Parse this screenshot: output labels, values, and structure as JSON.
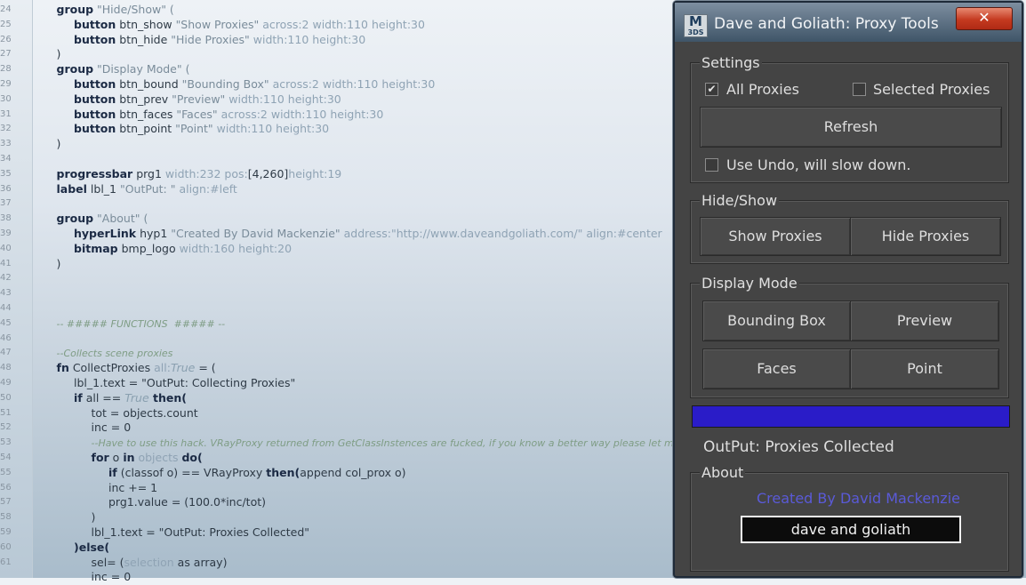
{
  "editor": {
    "line_numbers": [
      "24",
      "25",
      "26",
      "27",
      "28",
      "29",
      "30",
      "31",
      "32",
      "33",
      "34",
      "35",
      "36",
      "37",
      "38",
      "39",
      "40",
      "41",
      "42",
      "43",
      "44",
      "45",
      "46",
      "47",
      "48",
      "49",
      "50",
      "51",
      "52",
      "53",
      "54",
      "55",
      "56",
      "57",
      "58",
      "59",
      "60",
      "61"
    ],
    "lines": [
      {
        "indent": 1,
        "tokens": [
          {
            "t": "group",
            "c": "kw"
          },
          {
            "t": " \"Hide/Show\" (",
            "c": "str"
          }
        ]
      },
      {
        "indent": 2,
        "tokens": [
          {
            "t": "button",
            "c": "kw"
          },
          {
            "t": " btn_show ",
            "c": "plain"
          },
          {
            "t": "\"Show Proxies\"",
            "c": "str"
          },
          {
            "t": " across:2 width:110 height:30",
            "c": "prop"
          }
        ]
      },
      {
        "indent": 2,
        "tokens": [
          {
            "t": "button",
            "c": "kw"
          },
          {
            "t": " btn_hide ",
            "c": "plain"
          },
          {
            "t": "\"Hide Proxies\"",
            "c": "str"
          },
          {
            "t": " width:110 height:30",
            "c": "prop"
          }
        ]
      },
      {
        "indent": 1,
        "tokens": [
          {
            "t": ")",
            "c": "plain"
          }
        ]
      },
      {
        "indent": 1,
        "tokens": [
          {
            "t": "group",
            "c": "kw"
          },
          {
            "t": " \"Display Mode\" (",
            "c": "str"
          }
        ]
      },
      {
        "indent": 2,
        "tokens": [
          {
            "t": "button",
            "c": "kw"
          },
          {
            "t": " btn_bound ",
            "c": "plain"
          },
          {
            "t": "\"Bounding Box\"",
            "c": "str"
          },
          {
            "t": " across:2 width:110 height:30",
            "c": "prop"
          }
        ]
      },
      {
        "indent": 2,
        "tokens": [
          {
            "t": "button",
            "c": "kw"
          },
          {
            "t": " btn_prev ",
            "c": "plain"
          },
          {
            "t": "\"Preview\"",
            "c": "str"
          },
          {
            "t": " width:110 height:30",
            "c": "prop"
          }
        ]
      },
      {
        "indent": 2,
        "tokens": [
          {
            "t": "button",
            "c": "kw"
          },
          {
            "t": " btn_faces ",
            "c": "plain"
          },
          {
            "t": "\"Faces\"",
            "c": "str"
          },
          {
            "t": " across:2 width:110 height:30",
            "c": "prop"
          }
        ]
      },
      {
        "indent": 2,
        "tokens": [
          {
            "t": "button",
            "c": "kw"
          },
          {
            "t": " btn_point ",
            "c": "plain"
          },
          {
            "t": "\"Point\"",
            "c": "str"
          },
          {
            "t": " width:110 height:30",
            "c": "prop"
          }
        ]
      },
      {
        "indent": 1,
        "tokens": [
          {
            "t": ")",
            "c": "plain"
          }
        ]
      },
      {
        "indent": 0,
        "tokens": []
      },
      {
        "indent": 1,
        "tokens": [
          {
            "t": "progressbar",
            "c": "kw"
          },
          {
            "t": " prg1 ",
            "c": "plain"
          },
          {
            "t": "width:232 pos:",
            "c": "prop"
          },
          {
            "t": "[4,260]",
            "c": "plain"
          },
          {
            "t": "height:19",
            "c": "prop"
          }
        ]
      },
      {
        "indent": 1,
        "tokens": [
          {
            "t": "label",
            "c": "kw"
          },
          {
            "t": " lbl_1 ",
            "c": "plain"
          },
          {
            "t": "\"OutPut: \"",
            "c": "str"
          },
          {
            "t": " align:#left",
            "c": "prop"
          }
        ]
      },
      {
        "indent": 0,
        "tokens": []
      },
      {
        "indent": 1,
        "tokens": [
          {
            "t": "group",
            "c": "kw"
          },
          {
            "t": " \"About\" (",
            "c": "str"
          }
        ]
      },
      {
        "indent": 2,
        "tokens": [
          {
            "t": "hyperLink",
            "c": "kw"
          },
          {
            "t": " hyp1 ",
            "c": "plain"
          },
          {
            "t": "\"Created By David Mackenzie\"",
            "c": "str"
          },
          {
            "t": " address:\"http://www.daveandgoliath.com/\" align:#center",
            "c": "prop"
          }
        ]
      },
      {
        "indent": 2,
        "tokens": [
          {
            "t": "bitmap",
            "c": "kw"
          },
          {
            "t": " bmp_logo ",
            "c": "plain"
          },
          {
            "t": "width:160 height:20",
            "c": "prop"
          }
        ]
      },
      {
        "indent": 1,
        "tokens": [
          {
            "t": ")",
            "c": "plain"
          }
        ]
      },
      {
        "indent": 0,
        "tokens": []
      },
      {
        "indent": 0,
        "tokens": []
      },
      {
        "indent": 0,
        "tokens": []
      },
      {
        "indent": 1,
        "tokens": [
          {
            "t": "-- ##### FUNCTIONS  ##### --",
            "c": "cmt"
          }
        ]
      },
      {
        "indent": 0,
        "tokens": []
      },
      {
        "indent": 1,
        "tokens": [
          {
            "t": "--Collects scene proxies",
            "c": "cmt"
          }
        ]
      },
      {
        "indent": 1,
        "tokens": [
          {
            "t": "fn",
            "c": "kw"
          },
          {
            "t": " CollectProxies ",
            "c": "plain"
          },
          {
            "t": "all:",
            "c": "prop"
          },
          {
            "t": "True",
            "c": "bool"
          },
          {
            "t": " = (",
            "c": "plain"
          }
        ]
      },
      {
        "indent": 2,
        "tokens": [
          {
            "t": "lbl_1.text = \"OutPut: Collecting Proxies\"",
            "c": "plain"
          }
        ]
      },
      {
        "indent": 2,
        "tokens": [
          {
            "t": "if",
            "c": "kw"
          },
          {
            "t": " all == ",
            "c": "plain"
          },
          {
            "t": "True",
            "c": "bool"
          },
          {
            "t": " then(",
            "c": "kw"
          }
        ]
      },
      {
        "indent": 3,
        "tokens": [
          {
            "t": "tot = objects.count",
            "c": "plain"
          }
        ]
      },
      {
        "indent": 3,
        "tokens": [
          {
            "t": "inc = 0",
            "c": "plain"
          }
        ]
      },
      {
        "indent": 3,
        "tokens": [
          {
            "t": "--Have to use this hack. VRayProxy returned from GetClassInstences are fucked, if you know a better way please let me know",
            "c": "cmt"
          }
        ]
      },
      {
        "indent": 3,
        "tokens": [
          {
            "t": "for",
            "c": "kw"
          },
          {
            "t": " o ",
            "c": "plain"
          },
          {
            "t": "in",
            "c": "kw"
          },
          {
            "t": " objects ",
            "c": "prop"
          },
          {
            "t": "do(",
            "c": "kw"
          }
        ]
      },
      {
        "indent": 4,
        "tokens": [
          {
            "t": "if",
            "c": "kw"
          },
          {
            "t": " (classof o) == VRayProxy ",
            "c": "plain"
          },
          {
            "t": "then(",
            "c": "kw"
          },
          {
            "t": "append col_prox o)",
            "c": "plain"
          }
        ]
      },
      {
        "indent": 4,
        "tokens": [
          {
            "t": "inc += 1",
            "c": "plain"
          }
        ]
      },
      {
        "indent": 4,
        "tokens": [
          {
            "t": "prg1.value = (100.0*inc/tot)",
            "c": "plain"
          }
        ]
      },
      {
        "indent": 3,
        "tokens": [
          {
            "t": ")",
            "c": "plain"
          }
        ]
      },
      {
        "indent": 3,
        "tokens": [
          {
            "t": "lbl_1.text = \"OutPut: Proxies Collected\"",
            "c": "plain"
          }
        ]
      },
      {
        "indent": 2,
        "tokens": [
          {
            "t": ")else(",
            "c": "kw"
          }
        ]
      },
      {
        "indent": 3,
        "tokens": [
          {
            "t": "sel= (",
            "c": "plain"
          },
          {
            "t": "selection",
            "c": "prop"
          },
          {
            "t": " as array)",
            "c": "plain"
          }
        ]
      },
      {
        "indent": 3,
        "tokens": [
          {
            "t": "inc = 0",
            "c": "plain"
          }
        ]
      }
    ]
  },
  "dialog": {
    "title": "Dave and Goliath: Proxy Tools",
    "icon_text_top": "M",
    "icon_text_bottom": "3DS",
    "close_label": "✕",
    "settings": {
      "title": "Settings",
      "all_proxies_label": "All Proxies",
      "all_proxies_checked": true,
      "selected_proxies_label": "Selected Proxies",
      "selected_proxies_checked": false,
      "refresh_label": "Refresh",
      "use_undo_label": "Use Undo, will slow down.",
      "use_undo_checked": false
    },
    "hide_show": {
      "title": "Hide/Show",
      "show_label": "Show Proxies",
      "hide_label": "Hide Proxies"
    },
    "display_mode": {
      "title": "Display Mode",
      "bounding_box_label": "Bounding Box",
      "preview_label": "Preview",
      "faces_label": "Faces",
      "point_label": "Point"
    },
    "progress": {
      "value": 1.0,
      "color": "#2a1cc8"
    },
    "output_label": "OutPut: Proxies Collected",
    "about": {
      "title": "About",
      "link_label": "Created By David Mackenzie",
      "logo_text": "dave and goliath"
    }
  }
}
